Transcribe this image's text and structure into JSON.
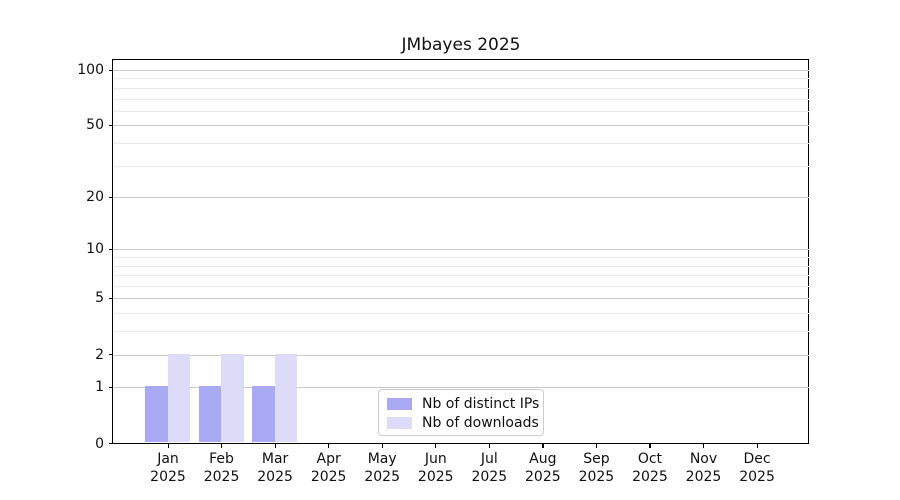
{
  "chart_data": {
    "type": "bar",
    "title": "JMbayes 2025",
    "year": "2025",
    "categories": [
      "Jan",
      "Feb",
      "Mar",
      "Apr",
      "May",
      "Jun",
      "Jul",
      "Aug",
      "Sep",
      "Oct",
      "Nov",
      "Dec"
    ],
    "series": [
      {
        "name": "Nb of distinct IPs",
        "color": "#a9a9f4",
        "values": [
          1,
          1,
          1,
          0,
          0,
          0,
          0,
          0,
          0,
          0,
          0,
          0
        ]
      },
      {
        "name": "Nb of downloads",
        "color": "#dcdcf8",
        "values": [
          2,
          2,
          2,
          0,
          0,
          0,
          0,
          0,
          0,
          0,
          0,
          0
        ]
      }
    ],
    "xlabel": "",
    "ylabel": "",
    "yscale": "log1p",
    "ylim": [
      0,
      115
    ],
    "yticks": [
      0,
      1,
      2,
      5,
      10,
      20,
      50,
      100
    ],
    "yticks_minor": [
      3,
      4,
      6,
      7,
      8,
      9,
      30,
      40,
      60,
      70,
      80,
      90
    ],
    "grid": "on",
    "legend_position": "inside bottom-center",
    "colors": {
      "major_grid": "#c9c9c9",
      "minor_grid": "#ebebeb",
      "spine": "#000000",
      "text": "#111111",
      "background": "#ffffff"
    }
  }
}
